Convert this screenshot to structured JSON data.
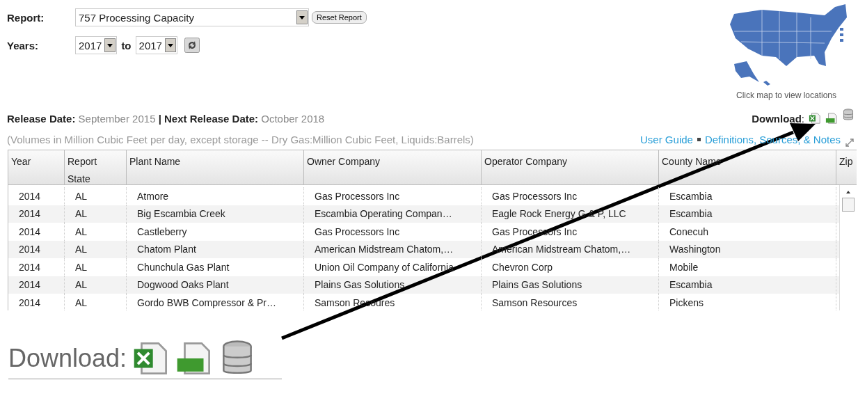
{
  "form": {
    "report_label": "Report:",
    "report_value": "757 Processing Capacity",
    "reset_button": "Reset Report",
    "years_label": "Years:",
    "year_from": "2017",
    "to_label": "to",
    "year_to": "2017"
  },
  "map": {
    "kind": "picture",
    "caption": "Click map to view locations"
  },
  "release": {
    "label": "Release Date:",
    "date": "September 2015",
    "separator": "|",
    "next_label": "Next Release Date:",
    "next_date": "October 2018"
  },
  "download": {
    "label": "**Download**:"
  },
  "units_note": "(Volumes in Million Cubic Feet per day, except storage -- Dry Gas:Million Cubic Feet, Liquids:Barrels)",
  "links": [
    "User Guide",
    "Definitions, Sources, & Notes"
  ],
  "table": {
    "columns": [
      "Year",
      "Report State",
      "Plant Name",
      "Owner Company",
      "Operator Company",
      "County Name",
      "Zip"
    ],
    "rows": [
      [
        "2014",
        "AL",
        "Atmore",
        "Gas Processors Inc",
        "Gas Processors Inc",
        "Escambia"
      ],
      [
        "2014",
        "AL",
        "Big Escambia Creek",
        "Escambia Operating Compan…",
        "Eagle Rock Energy G & P, LLC",
        "Escambia"
      ],
      [
        "2014",
        "AL",
        "Castleberry",
        "Gas Processors Inc",
        "Gas Processors Inc",
        "Conecuh"
      ],
      [
        "2014",
        "AL",
        "Chatom Plant",
        "American Midstream Chatom,…",
        "American Midstream Chatom,…",
        "Washington"
      ],
      [
        "2014",
        "AL",
        "Chunchula Gas Plant",
        "Union Oil Company of California",
        "Chevron Corp",
        "Mobile"
      ],
      [
        "2014",
        "AL",
        "Dogwood Oaks Plant",
        "Plains Gas Solutions",
        "Plains Gas Solutions",
        "Escambia"
      ],
      [
        "2014",
        "AL",
        "Gordo BWB Compressor & Pr…",
        "Samson Resoures",
        "Samson Resources",
        "Pickens"
      ]
    ]
  },
  "callout": {
    "label": "Download:"
  }
}
